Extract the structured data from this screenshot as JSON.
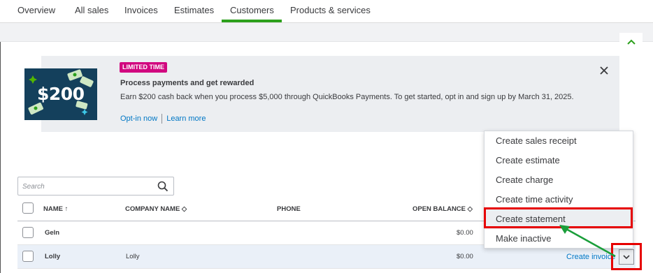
{
  "tabs": [
    {
      "label": "Overview"
    },
    {
      "label": "All sales"
    },
    {
      "label": "Invoices"
    },
    {
      "label": "Estimates"
    },
    {
      "label": "Customers"
    },
    {
      "label": "Products & services"
    }
  ],
  "active_tab": "Customers",
  "promo": {
    "image_amount": "$200",
    "badge": "LIMITED TIME",
    "title": "Process payments and get rewarded",
    "body": "Earn $200 cash back when you process $5,000 through QuickBooks Payments. To get started, opt in and sign up by March 31, 2025.",
    "opt_in": "Opt-in now",
    "learn_more": "Learn more"
  },
  "search": {
    "placeholder": "Search"
  },
  "table": {
    "columns": {
      "name": "NAME ↑",
      "company": "COMPANY NAME ◇",
      "phone": "PHONE",
      "balance": "OPEN BALANCE ◇"
    },
    "rows": [
      {
        "name": "Geln",
        "company": "",
        "phone": "",
        "balance": "$0.00"
      },
      {
        "name": "Lolly",
        "company": "Lolly",
        "phone": "",
        "balance": "$0.00",
        "action": "Create invoice"
      }
    ]
  },
  "menu": {
    "items": [
      "Create sales receipt",
      "Create estimate",
      "Create charge",
      "Create time activity",
      "Create statement",
      "Make inactive"
    ],
    "highlighted": "Create statement"
  },
  "colors": {
    "accent_green": "#2ca01c",
    "link_blue": "#0077c5",
    "badge_magenta": "#d1077f",
    "annotation_red": "#e60000",
    "annotation_arrow_green": "#1a9e3a",
    "promo_navy": "#14405c"
  },
  "icons": [
    "chevron-up-icon",
    "close-icon",
    "search-icon",
    "sort-up-icon",
    "sort-icon",
    "chevron-down-icon"
  ]
}
